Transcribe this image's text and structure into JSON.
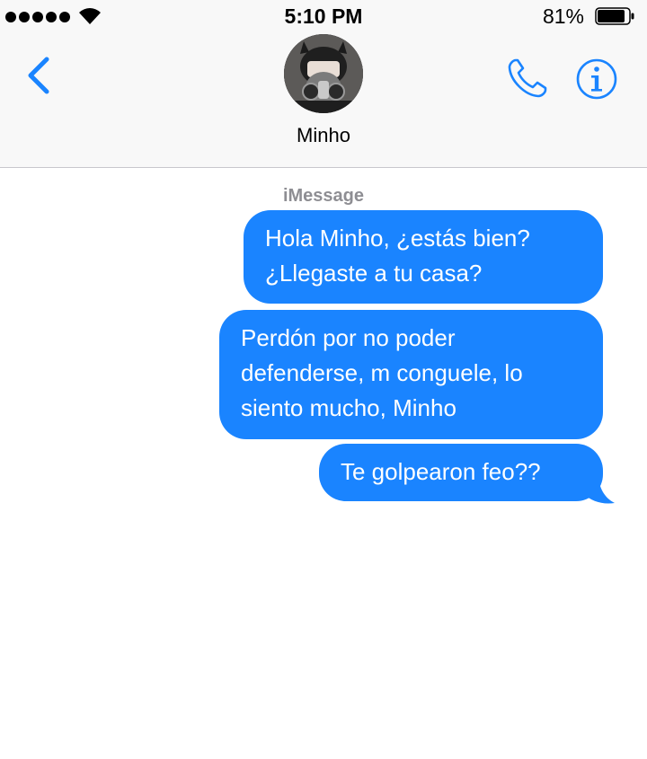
{
  "status_bar": {
    "time": "5:10 PM",
    "battery_percent": "81%",
    "battery_level": 0.81,
    "signal_bars": 5,
    "icons": [
      "signal-icon",
      "wifi-icon",
      "battery-icon"
    ]
  },
  "header": {
    "contact_name": "Minho",
    "icons": [
      "back-chevron-icon",
      "phone-icon",
      "info-icon"
    ],
    "accent_color": "#1a84ff"
  },
  "conversation": {
    "service_label": "iMessage",
    "messages": [
      {
        "sender": "me",
        "text": "Hola Minho, ¿estás bien?\n¿Llegaste a tu casa?"
      },
      {
        "sender": "me",
        "text": "Perdón por no poder\ndefenderse, m conguele, lo\nsiento mucho, Minho"
      },
      {
        "sender": "me",
        "text": "Te golpearon feo??"
      }
    ],
    "bubble_color": "#1a84ff"
  }
}
